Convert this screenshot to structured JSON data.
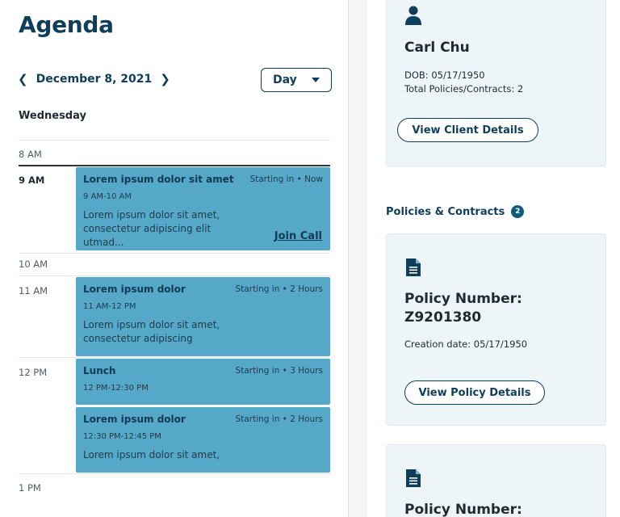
{
  "page_title": "Agenda",
  "date_nav": {
    "date": "December 8, 2021",
    "view_select": "Day"
  },
  "day_name": "Wednesday",
  "times": [
    "8 AM",
    "9 AM",
    "10 AM",
    "11 AM",
    "12 PM",
    "1 PM"
  ],
  "events": [
    {
      "title": "Lorem ipsum dolor sit amet",
      "starting": "Starting in • Now",
      "time": "9 AM-10 AM",
      "desc": "Lorem ipsum dolor sit amet, consectetur adipiscing elit utmad...",
      "action": "Join Call"
    },
    {
      "title": "Lorem ipsum dolor",
      "starting": "Starting in • 2 Hours",
      "time": "11 AM-12 PM",
      "desc": "Lorem ipsum dolor sit amet, consectetur adipiscing"
    },
    {
      "title": "Lunch",
      "starting": "Starting in • 3 Hours",
      "time": "12 PM-12:30 PM"
    },
    {
      "title": "Lorem ipsum dolor",
      "starting": "Starting in • 2 Hours",
      "time": "12:30 PM-12:45 PM",
      "desc": "Lorem ipsum dolor sit amet,"
    }
  ],
  "client": {
    "name": "Carl Chu",
    "dob": "DOB: 05/17/1950",
    "policies": "Total Policies/Contracts: 2",
    "button": "View Client Details",
    "icon": "person-icon"
  },
  "policies_section": {
    "label": "Policies & Contracts",
    "count": "2",
    "items": [
      {
        "number_label": "Policy Number:",
        "number": "Z9201380",
        "creation": "Creation date: 05/17/1950",
        "button": "View Policy Details",
        "icon": "document-icon"
      },
      {
        "number_label": "Policy Number:",
        "icon": "document-icon"
      }
    ]
  },
  "colors": {
    "primary": "#0f3d5c",
    "event": "#55a8c8",
    "card": "#eef5f8"
  }
}
